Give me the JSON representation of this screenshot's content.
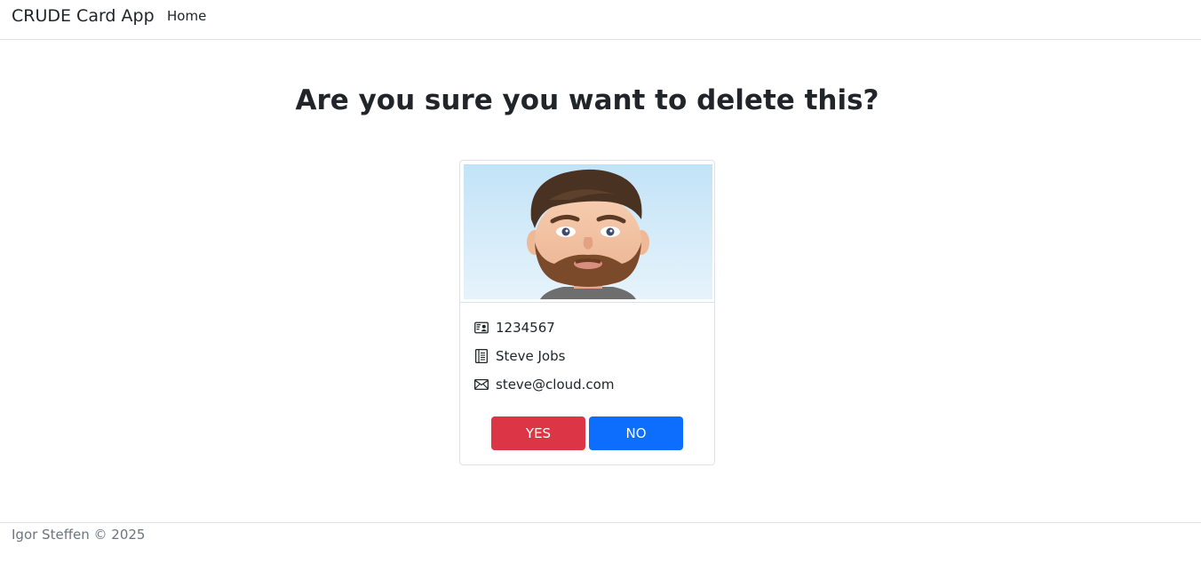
{
  "navbar": {
    "brand": "CRUDE Card App",
    "links": [
      {
        "label": "Home"
      }
    ]
  },
  "main": {
    "heading": "Are you sure you want to delete this?"
  },
  "card": {
    "image_icon": "bearded-man-avatar",
    "fields": {
      "id": {
        "icon": "person-vcard-icon",
        "value": "1234567"
      },
      "name": {
        "icon": "journal-icon",
        "value": "Steve Jobs"
      },
      "email": {
        "icon": "envelope-icon",
        "value": "steve@cloud.com"
      }
    },
    "yes_label": "YES",
    "no_label": "NO"
  },
  "footer": {
    "text": "Igor Steffen © 2025"
  },
  "colors": {
    "danger": "#dc3545",
    "primary": "#0d6efd",
    "border": "#dee2e6",
    "muted": "#6c757d"
  }
}
